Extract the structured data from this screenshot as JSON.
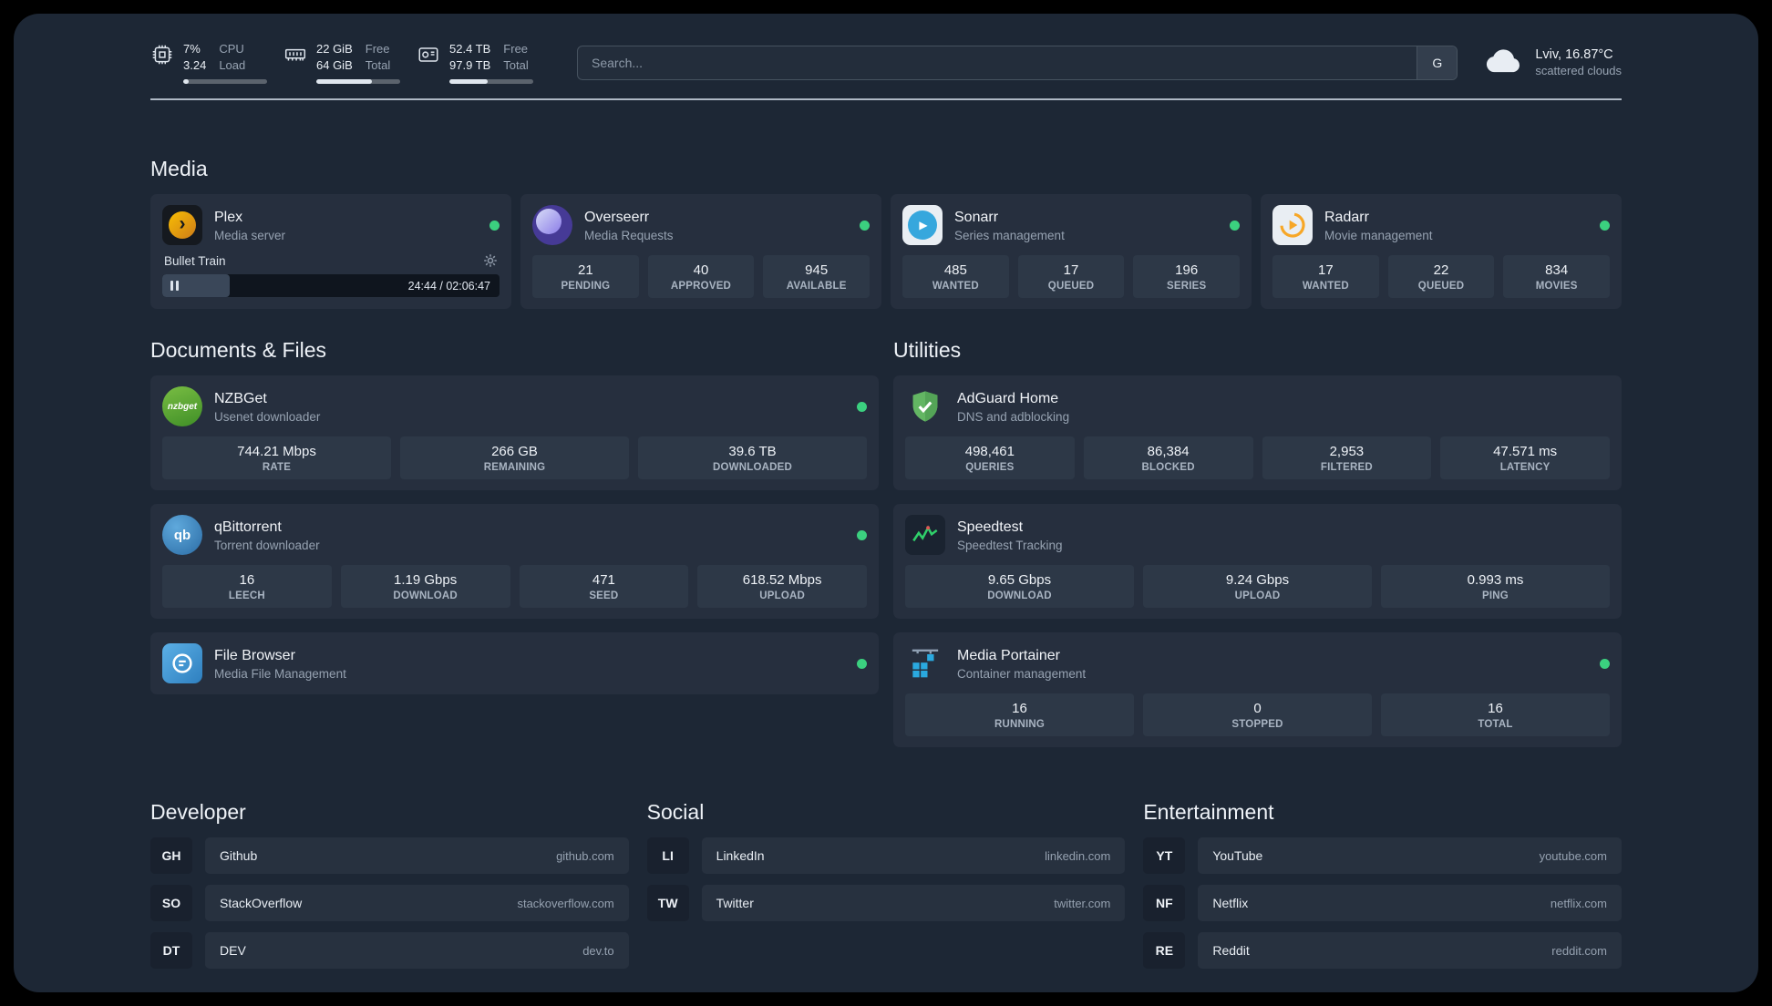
{
  "topbar": {
    "cpu": {
      "value_top": "7%",
      "value_bottom": "3.24",
      "label_top": "CPU",
      "label_bottom": "Load",
      "bar_percent": 7
    },
    "ram": {
      "value_top": "22 GiB",
      "value_bottom": "64 GiB",
      "label_top": "Free",
      "label_bottom": "Total",
      "bar_percent": 66
    },
    "disk": {
      "value_top": "52.4 TB",
      "value_bottom": "97.9 TB",
      "label_top": "Free",
      "label_bottom": "Total",
      "bar_percent": 46
    },
    "search": {
      "placeholder": "Search...",
      "provider_label": "G"
    },
    "weather": {
      "location": "Lviv, 16.87°C",
      "condition": "scattered clouds"
    }
  },
  "sections": {
    "media": "Media",
    "documents": "Documents & Files",
    "utilities": "Utilities",
    "developer": "Developer",
    "social": "Social",
    "entertainment": "Entertainment"
  },
  "icons": {
    "plex_chevron": "›",
    "sonarr_play": "▶",
    "nzbget_text": "nzbget",
    "qb_text": "qb"
  },
  "services": {
    "plex": {
      "name": "Plex",
      "subtitle": "Media server",
      "now_playing": "Bullet Train",
      "time": "24:44 / 02:06:47",
      "progress_percent": 20
    },
    "overseerr": {
      "name": "Overseerr",
      "subtitle": "Media Requests",
      "stats": [
        {
          "value": "21",
          "label": "PENDING"
        },
        {
          "value": "40",
          "label": "APPROVED"
        },
        {
          "value": "945",
          "label": "AVAILABLE"
        }
      ]
    },
    "sonarr": {
      "name": "Sonarr",
      "subtitle": "Series management",
      "stats": [
        {
          "value": "485",
          "label": "WANTED"
        },
        {
          "value": "17",
          "label": "QUEUED"
        },
        {
          "value": "196",
          "label": "SERIES"
        }
      ]
    },
    "radarr": {
      "name": "Radarr",
      "subtitle": "Movie management",
      "stats": [
        {
          "value": "17",
          "label": "WANTED"
        },
        {
          "value": "22",
          "label": "QUEUED"
        },
        {
          "value": "834",
          "label": "MOVIES"
        }
      ]
    },
    "nzbget": {
      "name": "NZBGet",
      "subtitle": "Usenet downloader",
      "stats": [
        {
          "value": "744.21 Mbps",
          "label": "RATE"
        },
        {
          "value": "266 GB",
          "label": "REMAINING"
        },
        {
          "value": "39.6 TB",
          "label": "DOWNLOADED"
        }
      ]
    },
    "qbittorrent": {
      "name": "qBittorrent",
      "subtitle": "Torrent downloader",
      "stats": [
        {
          "value": "16",
          "label": "LEECH"
        },
        {
          "value": "1.19 Gbps",
          "label": "DOWNLOAD"
        },
        {
          "value": "471",
          "label": "SEED"
        },
        {
          "value": "618.52 Mbps",
          "label": "UPLOAD"
        }
      ]
    },
    "filebrowser": {
      "name": "File Browser",
      "subtitle": "Media File Management"
    },
    "adguard": {
      "name": "AdGuard Home",
      "subtitle": "DNS and adblocking",
      "stats": [
        {
          "value": "498,461",
          "label": "QUERIES"
        },
        {
          "value": "86,384",
          "label": "BLOCKED"
        },
        {
          "value": "2,953",
          "label": "FILTERED"
        },
        {
          "value": "47.571 ms",
          "label": "LATENCY"
        }
      ]
    },
    "speedtest": {
      "name": "Speedtest",
      "subtitle": "Speedtest Tracking",
      "stats": [
        {
          "value": "9.65 Gbps",
          "label": "DOWNLOAD"
        },
        {
          "value": "9.24 Gbps",
          "label": "UPLOAD"
        },
        {
          "value": "0.993 ms",
          "label": "PING"
        }
      ]
    },
    "portainer": {
      "name": "Media Portainer",
      "subtitle": "Container management",
      "stats": [
        {
          "value": "16",
          "label": "RUNNING"
        },
        {
          "value": "0",
          "label": "STOPPED"
        },
        {
          "value": "16",
          "label": "TOTAL"
        }
      ]
    }
  },
  "bookmarks": {
    "developer": [
      {
        "abbr": "GH",
        "name": "Github",
        "domain": "github.com"
      },
      {
        "abbr": "SO",
        "name": "StackOverflow",
        "domain": "stackoverflow.com"
      },
      {
        "abbr": "DT",
        "name": "DEV",
        "domain": "dev.to"
      }
    ],
    "social": [
      {
        "abbr": "LI",
        "name": "LinkedIn",
        "domain": "linkedin.com"
      },
      {
        "abbr": "TW",
        "name": "Twitter",
        "domain": "twitter.com"
      }
    ],
    "entertainment": [
      {
        "abbr": "YT",
        "name": "YouTube",
        "domain": "youtube.com"
      },
      {
        "abbr": "NF",
        "name": "Netflix",
        "domain": "netflix.com"
      },
      {
        "abbr": "RE",
        "name": "Reddit",
        "domain": "reddit.com"
      }
    ]
  }
}
